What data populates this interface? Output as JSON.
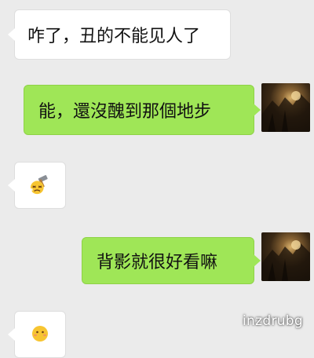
{
  "messages": [
    {
      "side": "incoming",
      "text": "咋了，丑的不能见人了"
    },
    {
      "side": "outgoing",
      "text": "能，還沒醜到那個地步"
    },
    {
      "side": "incoming",
      "type": "emoji",
      "emoji": "hammer-face-emoji"
    },
    {
      "side": "outgoing",
      "text": "背影就很好看嘛"
    },
    {
      "side": "incoming",
      "type": "emoji",
      "emoji": "blushing-face-emoji"
    }
  ],
  "watermark": "inzdrubg",
  "colors": {
    "background": "#ebebeb",
    "incoming_bubble": "#ffffff",
    "outgoing_bubble": "#9fe657"
  }
}
